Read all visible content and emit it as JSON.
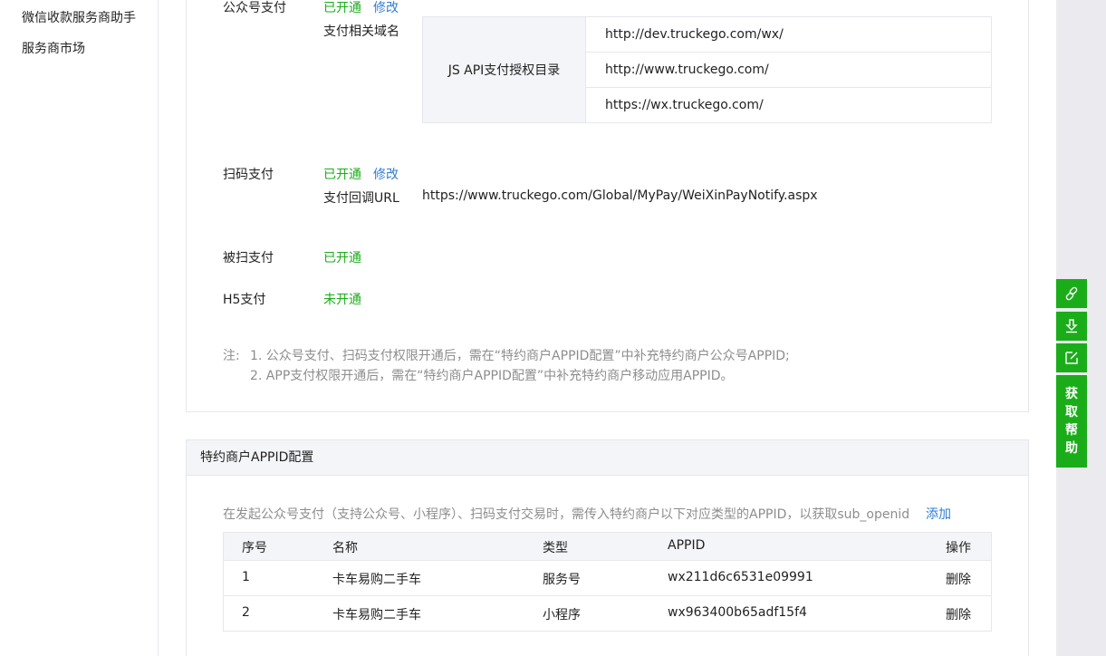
{
  "sidebar": {
    "items": [
      {
        "label": "微信收款服务商助手"
      },
      {
        "label": "服务商市场"
      }
    ]
  },
  "payments": {
    "official_account": {
      "label": "公众号支付",
      "status": "已开通",
      "modify": "修改",
      "domain_label": "支付相关域名",
      "jsapi_label": "JS API支付授权目录",
      "domains": [
        "http://dev.truckego.com/wx/",
        "http://www.truckego.com/",
        "https://wx.truckego.com/"
      ]
    },
    "scan": {
      "label": "扫码支付",
      "status": "已开通",
      "modify": "修改",
      "callback_label": "支付回调URL",
      "callback_url": "https://www.truckego.com/Global/MyPay/WeiXinPayNotify.aspx"
    },
    "micropay": {
      "label": "被扫支付",
      "status": "已开通"
    },
    "h5": {
      "label": "H5支付",
      "status": "未开通"
    },
    "notes": {
      "prefix": "注:",
      "line1": "1. 公众号支付、扫码支付权限开通后，需在“特约商户APPID配置”中补充特约商户公众号APPID;",
      "line2": "2. APP支付权限开通后，需在“特约商户APPID配置”中补充特约商户移动应用APPID。"
    }
  },
  "appid_config": {
    "title": "特约商户APPID配置",
    "description": "在发起公众号支付（支持公众号、小程序）、扫码支付交易时，需传入特约商户以下对应类型的APPID，以获取sub_openid",
    "add_label": "添加",
    "columns": [
      "序号",
      "名称",
      "类型",
      "APPID",
      "操作"
    ],
    "rows": [
      {
        "index": "1",
        "name": "卡车易购二手车",
        "type": "服务号",
        "appid": "wx211d6c6531e09991",
        "action": "删除"
      },
      {
        "index": "2",
        "name": "卡车易购二手车",
        "type": "小程序",
        "appid": "wx963400b65adf15f4",
        "action": "删除"
      }
    ]
  },
  "float_tools": {
    "icons": [
      "link-icon",
      "download-icon",
      "edit-icon"
    ],
    "help_chars": [
      "获",
      "取",
      "帮",
      "助"
    ]
  }
}
